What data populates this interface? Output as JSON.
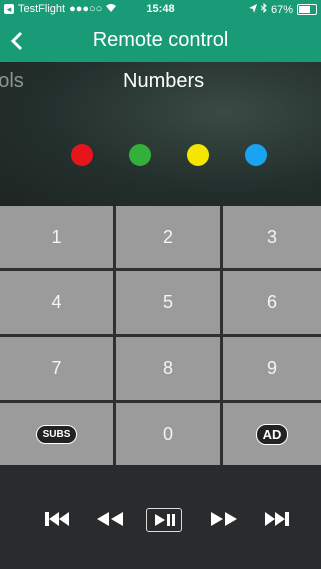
{
  "status_bar": {
    "carrier": "TestFlight",
    "signal": "●●●○○",
    "time": "15:48",
    "battery": "67%",
    "battery_level": 0.67
  },
  "nav": {
    "title": "Remote control",
    "back_icon": "chevron-left-icon"
  },
  "tabs": [
    {
      "label": "trols"
    },
    {
      "label": "Numbers"
    }
  ],
  "color_buttons": {
    "red": "#e8141c",
    "green": "#33b03a",
    "yellow": "#f5e600",
    "blue": "#1aa3f0"
  },
  "keypad": {
    "keys": [
      "1",
      "2",
      "3",
      "4",
      "5",
      "6",
      "7",
      "8",
      "9",
      "SUBS",
      "0",
      "AD"
    ]
  },
  "transport": {
    "icons": [
      "skip-back-icon",
      "rewind-icon",
      "play-pause-icon",
      "fast-forward-icon",
      "skip-forward-icon"
    ]
  }
}
